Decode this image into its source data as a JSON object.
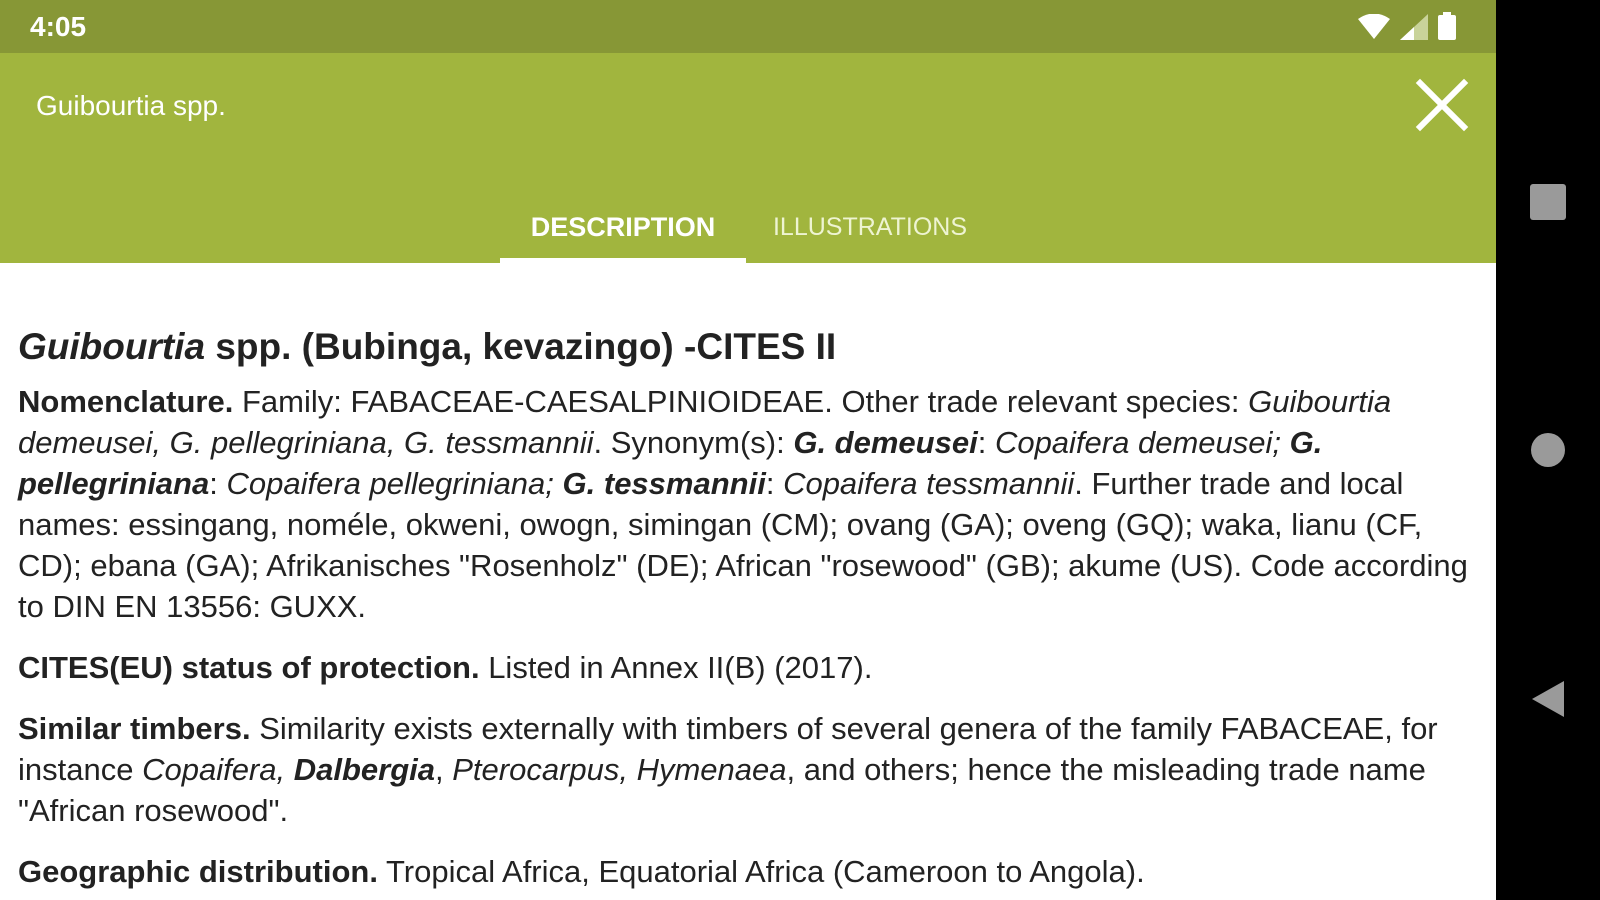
{
  "status_bar": {
    "time": "4:05",
    "icons": [
      "wifi-icon",
      "signal-icon",
      "battery-icon"
    ]
  },
  "app_bar": {
    "title": "Guibourtia spp.",
    "close_icon": "close-icon",
    "color": "#a1b53e"
  },
  "tabs": [
    {
      "label": "DESCRIPTION",
      "selected": true
    },
    {
      "label": "ILLUSTRATIONS",
      "selected": false
    }
  ],
  "content": {
    "heading": {
      "genus": "Guibourtia",
      "rest": " spp. (Bubinga, kevazingo) -CITES II"
    },
    "nomenclature": {
      "label": "Nomenclature.",
      "t1": " Family: FABACEAE-CAESALPINIOIDEAE. Other trade relevant species: ",
      "i1": "Guibourtia demeusei, G. pellegriniana, G. tessmannii",
      "t2": ". Synonym(s): ",
      "b1": "G. demeusei",
      "t3": ": ",
      "i2": "Copaifera demeusei;",
      "t4": " ",
      "b2": "G. pellegriniana",
      "t5": ": ",
      "i3": "Copaifera pellegriniana;",
      "t6": " ",
      "b3": "G. tessmannii",
      "t7": ": ",
      "i4": "Copaifera tessmannii",
      "t8": ". Further trade and local names: essingang, noméle, okweni, owogn, simingan (CM); ovang (GA); oveng (GQ); waka, lianu (CF, CD); ebana (GA); Afrikanisches \"Rosenholz\" (DE); African \"rosewood\" (GB); akume (US). Code according to DIN EN 13556: GUXX."
    },
    "cites": {
      "label": "CITES(EU) status of protection.",
      "text": " Listed in Annex II(B) (2017)."
    },
    "similar": {
      "label": "Similar timbers.",
      "t1": " Similarity exists externally with timbers of several genera of the family FABACEAE, for instance ",
      "i1": "Copaifera, ",
      "b1": "Dalbergia",
      "t2": ", ",
      "i2": "Pterocarpus, Hymenaea",
      "t3": ", and others; hence the misleading trade name \"African rosewood\"."
    },
    "geographic": {
      "label": "Geographic distribution.",
      "text": " Tropical Africa, Equatorial Africa (Cameroon to Angola)."
    }
  },
  "nav_bar": {
    "icons": [
      "recents-square-icon",
      "home-circle-icon",
      "back-triangle-icon"
    ]
  }
}
